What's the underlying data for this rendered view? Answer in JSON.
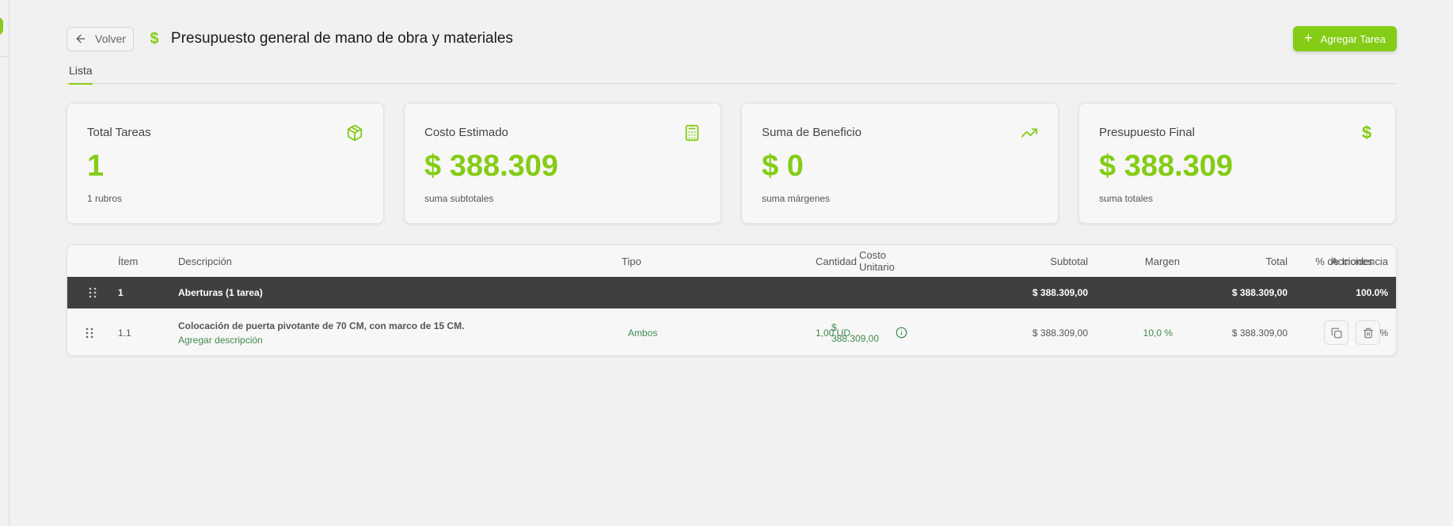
{
  "header": {
    "back_label": "Volver",
    "title_icon": "dollar-sign-icon",
    "title": "Presupuesto general de mano de obra y materiales",
    "add_label": "Agregar Tarea"
  },
  "tabs": [
    {
      "label": "Lista"
    }
  ],
  "cards": [
    {
      "label": "Total Tareas",
      "value": "1",
      "sub": "1 rubros",
      "icon": "package-icon"
    },
    {
      "label": "Costo Estimado",
      "value": "$ 388.309",
      "sub": "suma subtotales",
      "icon": "calculator-icon"
    },
    {
      "label": "Suma de Beneficio",
      "value": "$ 0",
      "sub": "suma márgenes",
      "icon": "trending-up-icon"
    },
    {
      "label": "Presupuesto Final",
      "value": "$ 388.309",
      "sub": "suma totales",
      "icon": "dollar-sign-icon"
    }
  ],
  "table": {
    "columns": {
      "item": "Ítem",
      "descripcion": "Descripción",
      "tipo": "Tipo",
      "cantidad": "Cantidad",
      "costo_unitario": "Costo Unitario",
      "subtotal": "Subtotal",
      "margen": "Margen",
      "total": "Total",
      "incidencia": "% de Incidencia",
      "acciones": "Acciones"
    },
    "group": {
      "item": "1",
      "descripcion": "Aberturas (1 tarea)",
      "subtotal": "$ 388.309,00",
      "total": "$ 388.309,00",
      "incidencia": "100.0%"
    },
    "task": {
      "item": "1.1",
      "descripcion": "Colocación de puerta pivotante de 70 CM, con marco de 15 CM.",
      "add_desc": "Agregar descripción",
      "tipo": "Ambos",
      "cantidad": "1,00 UD",
      "costo_unitario": "$ 388.309,00",
      "subtotal": "$ 388.309,00",
      "margen": "10,0 %",
      "total": "$ 388.309,00",
      "incidencia": "100.0%"
    }
  },
  "colors": {
    "accent": "#84cc16",
    "green_text": "#3f8a4e",
    "group_row": "#3f3f3f"
  }
}
